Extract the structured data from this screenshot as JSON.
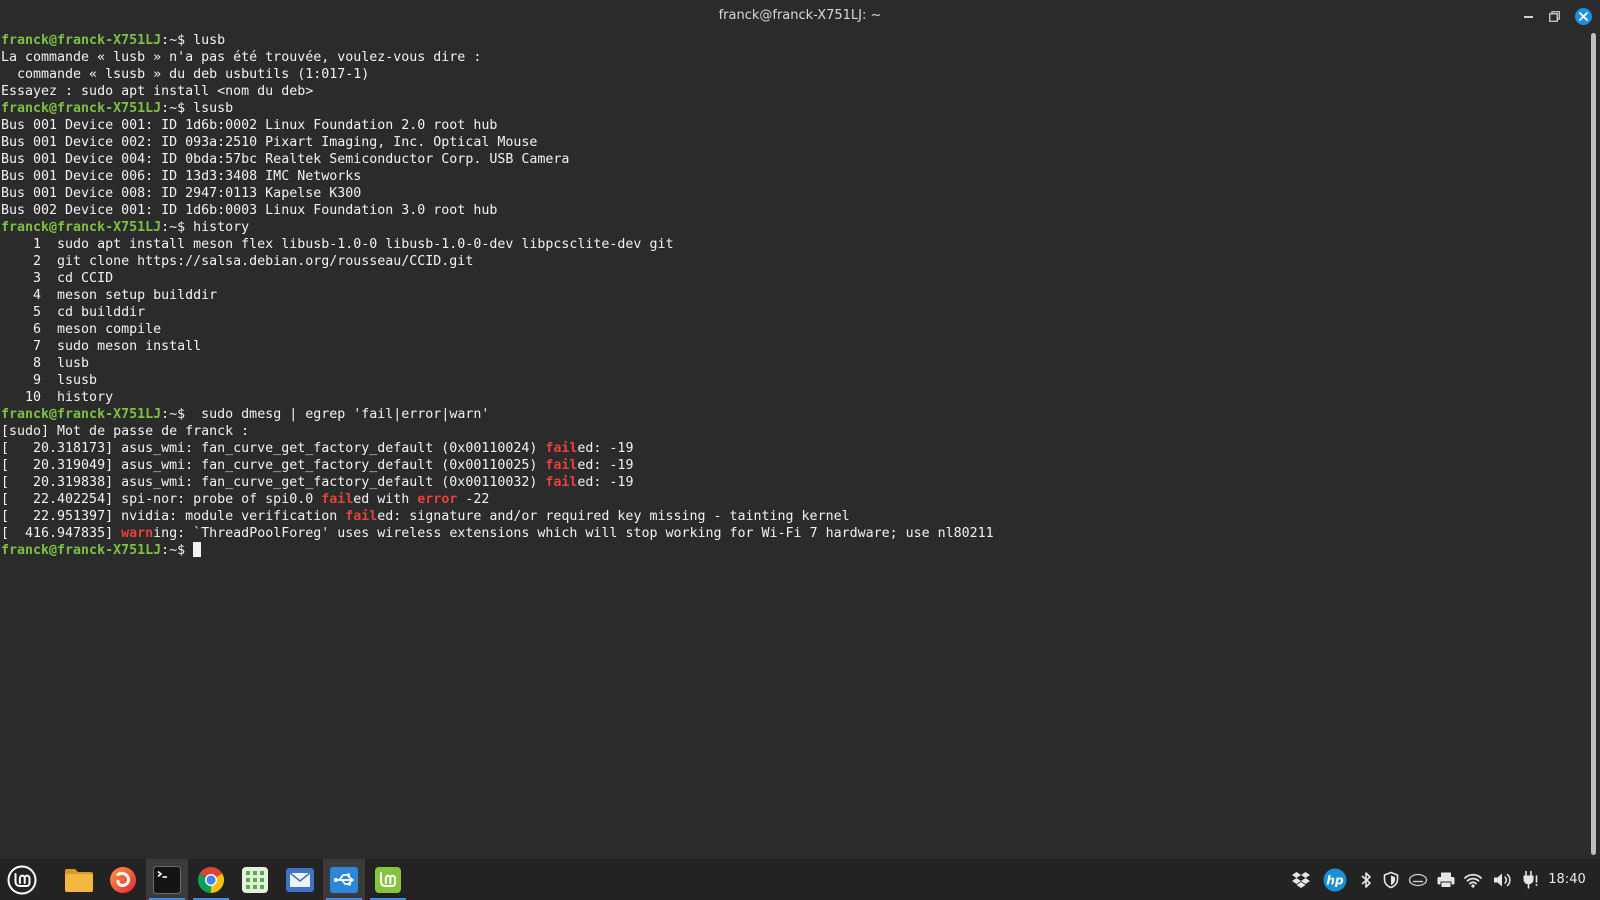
{
  "window": {
    "title": "franck@franck-X751LJ: ~",
    "controls": {
      "minimize": "minimize-icon",
      "maximize": "restore-icon",
      "close": "close-icon"
    }
  },
  "terminal": {
    "lines": [
      [
        "franck@franck-X751LJ",
        ":~$",
        " lusb"
      ],
      [
        "La commande « lusb » n'a pas été trouvée, voulez-vous dire :"
      ],
      [
        "  commande « lsusb » du deb usbutils (1:017-1)"
      ],
      [
        "Essayez : sudo apt install <nom du deb>"
      ],
      [
        "franck@franck-X751LJ",
        ":~$",
        " lsusb"
      ],
      [
        "Bus 001 Device 001: ID 1d6b:0002 Linux Foundation 2.0 root hub"
      ],
      [
        "Bus 001 Device 002: ID 093a:2510 Pixart Imaging, Inc. Optical Mouse"
      ],
      [
        "Bus 001 Device 004: ID 0bda:57bc Realtek Semiconductor Corp. USB Camera"
      ],
      [
        "Bus 001 Device 006: ID 13d3:3408 IMC Networks"
      ],
      [
        "Bus 001 Device 008: ID 2947:0113 Kapelse K300"
      ],
      [
        "Bus 002 Device 001: ID 1d6b:0003 Linux Foundation 3.0 root hub"
      ],
      [
        "franck@franck-X751LJ",
        ":~$",
        " history"
      ],
      [
        "    1  sudo apt install meson flex libusb-1.0-0 libusb-1.0-0-dev libpcsclite-dev git"
      ],
      [
        "    2  git clone https://salsa.debian.org/rousseau/CCID.git"
      ],
      [
        "    3  cd CCID"
      ],
      [
        "    4  meson setup builddir"
      ],
      [
        "    5  cd builddir"
      ],
      [
        "    6  meson compile"
      ],
      [
        "    7  sudo meson install"
      ],
      [
        "    8  lusb"
      ],
      [
        "    9  lsusb"
      ],
      [
        "   10  history"
      ],
      [
        "franck@franck-X751LJ",
        ":~$",
        "  sudo dmesg | egrep 'fail|error|warn'"
      ],
      [
        "[sudo] Mot de passe de franck : "
      ],
      [
        "[   20.318173] asus_wmi: fan_curve_get_factory_default (0x00110024) ",
        "fail",
        "ed: -19"
      ],
      [
        "[   20.319049] asus_wmi: fan_curve_get_factory_default (0x00110025) ",
        "fail",
        "ed: -19"
      ],
      [
        "[   20.319838] asus_wmi: fan_curve_get_factory_default (0x00110032) ",
        "fail",
        "ed: -19"
      ],
      [
        "[   22.402254] spi-nor: probe of spi0.0 ",
        "fail",
        "ed with ",
        "error",
        " -22"
      ],
      [
        "[   22.951397] nvidia: module verification ",
        "fail",
        "ed: signature and/or required key missing - tainting kernel"
      ],
      [
        "[  416.947835] ",
        "warn",
        "ing: `ThreadPoolForeg' uses wireless extensions which will stop working for Wi-Fi 7 hardware; use nl80211"
      ],
      [
        "franck@franck-X751LJ",
        ":~$"
      ]
    ]
  },
  "taskbar": {
    "menu_icon": "mint-menu-icon",
    "launchers": [
      {
        "icon": "files-icon",
        "active": false,
        "running": false
      },
      {
        "icon": "firefox-icon",
        "active": false,
        "running": false
      },
      {
        "icon": "terminal-icon",
        "active": true,
        "running": true
      },
      {
        "icon": "chrome-icon",
        "active": false,
        "running": true
      },
      {
        "icon": "spreadsheet-icon",
        "active": false,
        "running": false
      },
      {
        "icon": "mail-icon",
        "active": false,
        "running": false
      },
      {
        "icon": "usb-writer-icon",
        "active": true,
        "running": true
      },
      {
        "icon": "mint-app-icon",
        "active": false,
        "running": true
      }
    ],
    "tray": {
      "icons": [
        "dropbox-icon",
        "hp-icon",
        "bluetooth-icon",
        "shield-icon",
        "intel-icon",
        "printer-icon",
        "wifi-icon",
        "volume-icon",
        "power-icon"
      ],
      "hp_logo": "hp",
      "clock": "18:40"
    }
  },
  "colors": {
    "background": "#2b2b2b",
    "text": "#f2f2f2",
    "prompt_user": "#7dc142",
    "highlight": "#e8403a",
    "accent": "#3d8ee6",
    "close_button": "#1e8fe1",
    "taskbar": "#232323"
  }
}
